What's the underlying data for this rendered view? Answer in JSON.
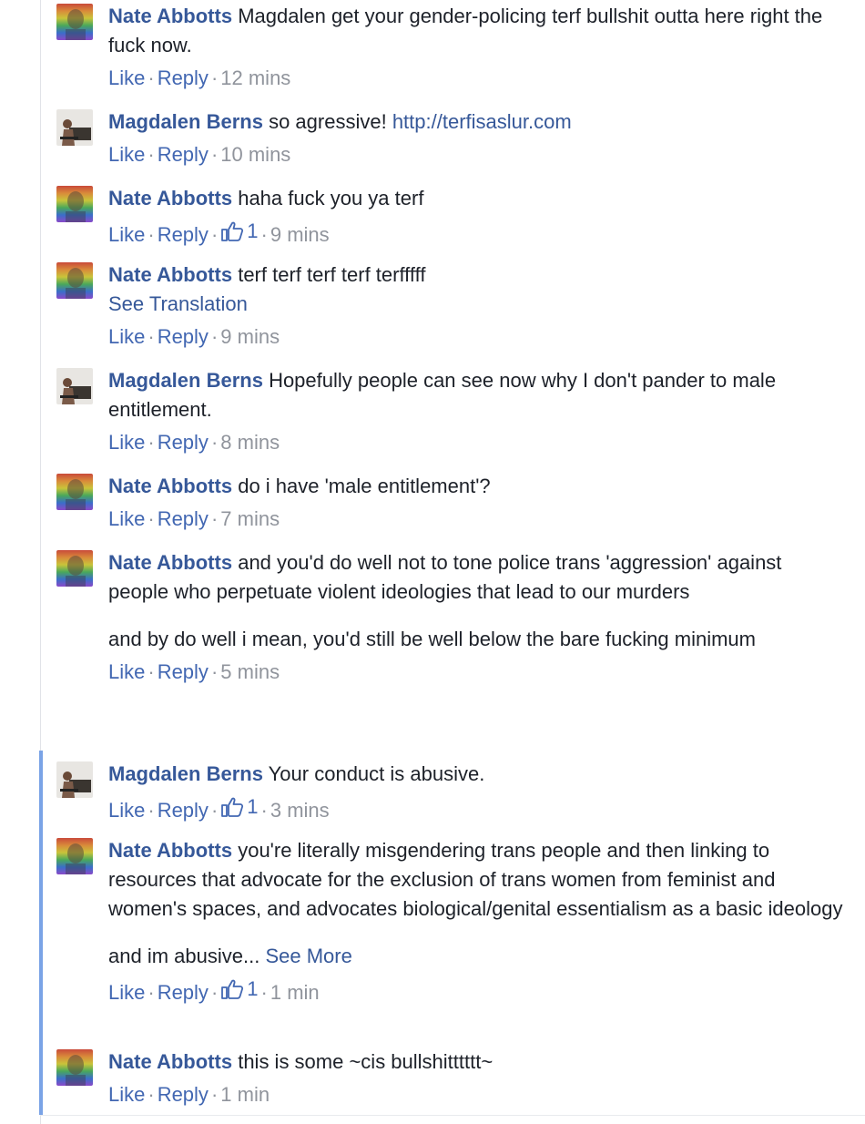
{
  "like_label": "Like",
  "reply_label": "Reply",
  "see_more_label": "See More",
  "colors": {
    "name": "#365899",
    "action": "#4267b2",
    "meta": "#90949c",
    "thread_bar": "#7aa3e6"
  },
  "comments": [
    {
      "author": "Nate Abbotts",
      "text": "Magdalen get your gender-policing terf bullshit outta here right the fuck now.",
      "likes": "",
      "time": "12 mins"
    },
    {
      "author": "Magdalen Berns",
      "text": "so agressive!",
      "link": "http://terfisaslur.com",
      "likes": "",
      "time": "10 mins"
    },
    {
      "author": "Nate Abbotts",
      "text": "haha fuck you ya terf",
      "likes": "1",
      "time": "9 mins"
    },
    {
      "author": "Nate Abbotts",
      "text": "terf terf terf terf terfffff",
      "translation_label": "See Translation",
      "likes": "",
      "time": "9 mins"
    },
    {
      "author": "Magdalen Berns",
      "text": "Hopefully people can see now why I don't pander to male entitlement.",
      "likes": "",
      "time": "8 mins"
    },
    {
      "author": "Nate Abbotts",
      "text": "do i have 'male entitlement'?",
      "likes": "",
      "time": "7 mins"
    },
    {
      "author": "Nate Abbotts",
      "text": "and you'd do well not to tone police trans 'aggression' against people who perpetuate violent ideologies that lead to our murders",
      "text2": "and by do well i mean, you'd still be well below the bare fucking minimum",
      "likes": "",
      "time": "5 mins"
    },
    {
      "author": "Magdalen Berns",
      "text": "Your conduct is abusive.",
      "likes": "1",
      "time": "3 mins"
    },
    {
      "author": "Nate Abbotts",
      "text": "you're literally misgendering trans people and then linking to resources that advocate for the exclusion of trans women from feminist and women's spaces, and advocates biological/genital essentialism as a basic ideology",
      "text2": "and im abusive...",
      "likes": "1",
      "time": "1 min"
    },
    {
      "author": "Nate Abbotts",
      "text": "this is some ~cis bullshitttttt~",
      "likes": "",
      "time": "1 min"
    }
  ]
}
